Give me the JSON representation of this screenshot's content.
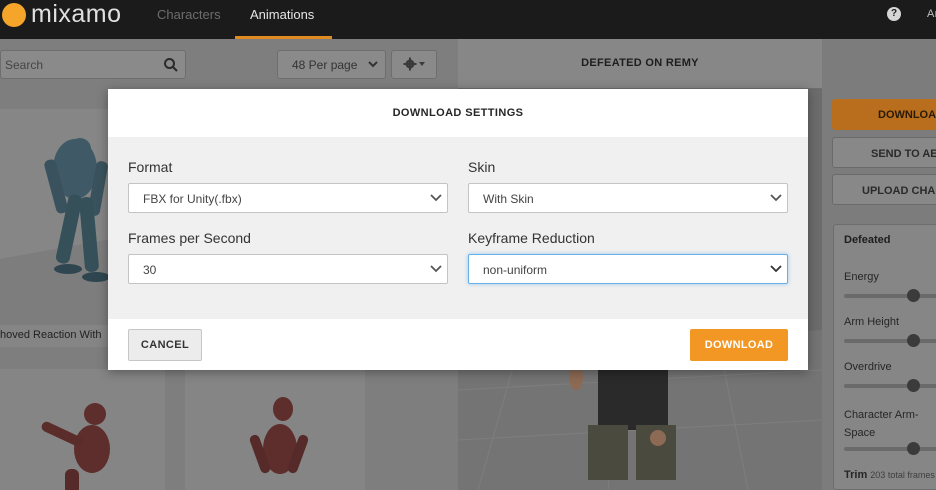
{
  "app": {
    "logo_text": "mixamo",
    "nav_tabs": [
      {
        "label": "Characters",
        "active": false
      },
      {
        "label": "Animations",
        "active": true
      }
    ],
    "help_icon": "question-circle-icon",
    "user_initials": "Aı",
    "accent_color": "#f29624"
  },
  "browser": {
    "search_placeholder": "Search",
    "per_page": "48 Per page",
    "cards": [
      {
        "caption": "hoved Reaction With"
      },
      {
        "caption": ""
      },
      {
        "caption": ""
      }
    ]
  },
  "preview": {
    "title": "DEFEATED ON REMY"
  },
  "right_panel": {
    "download_label": "DOWNLOAD",
    "send_label": "SEND TO AERO",
    "upload_label": "UPLOAD CHARACTER",
    "settings_title": "Defeated",
    "sliders": [
      {
        "label": "Energy",
        "value": 0.7
      },
      {
        "label": "Arm Height",
        "value": 0.7
      },
      {
        "label": "Overdrive",
        "value": 0.7
      },
      {
        "label": "Character Arm-Space",
        "value": 0.7
      }
    ],
    "trim_label": "Trim",
    "trim_sub": "203 total frames"
  },
  "modal": {
    "title": "DOWNLOAD SETTINGS",
    "fields": {
      "format": {
        "label": "Format",
        "value": "FBX for Unity(.fbx)"
      },
      "skin": {
        "label": "Skin",
        "value": "With Skin"
      },
      "fps": {
        "label": "Frames per Second",
        "value": "30"
      },
      "keyframe": {
        "label": "Keyframe Reduction",
        "value": "non-uniform"
      }
    },
    "cancel_label": "CANCEL",
    "download_label": "DOWNLOAD"
  }
}
